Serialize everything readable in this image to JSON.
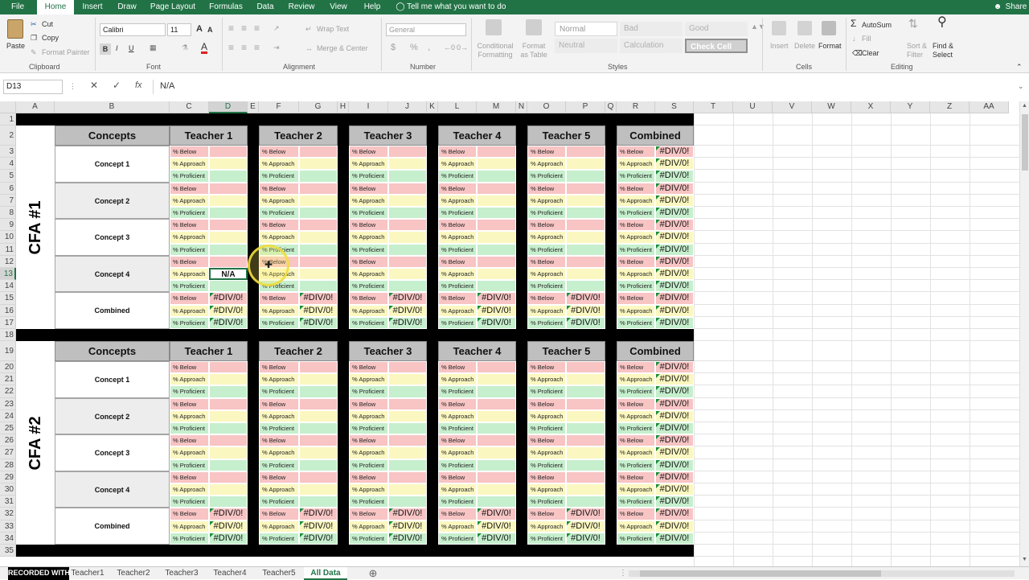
{
  "ribbon_tabs": [
    "File",
    "Home",
    "Insert",
    "Draw",
    "Page Layout",
    "Formulas",
    "Data",
    "Review",
    "View",
    "Help",
    "Tell me what you want to do"
  ],
  "active_tab": "Home",
  "share_label": "Share",
  "clipboard": {
    "paste": "Paste",
    "cut": "Cut",
    "copy": "Copy",
    "format_painter": "Format Painter",
    "label": "Clipboard"
  },
  "font": {
    "name": "Calibri",
    "size": "11",
    "label": "Font",
    "bold": "B",
    "italic": "I",
    "underline": "U",
    "grow": "A",
    "shrink": "A",
    "fontcolor": "A"
  },
  "alignment": {
    "wrap": "Wrap Text",
    "merge": "Merge & Center",
    "label": "Alignment"
  },
  "number": {
    "format": "General",
    "dollar": "$",
    "percent": "%",
    "comma": ",",
    "label": "Number"
  },
  "styles": {
    "conditional": "Conditional Formatting",
    "format_table": "Format as Table",
    "normal": "Normal",
    "bad": "Bad",
    "good": "Good",
    "neutral": "Neutral",
    "calculation": "Calculation",
    "check_cell": "Check Cell",
    "label": "Styles"
  },
  "cells": {
    "insert": "Insert",
    "delete": "Delete",
    "format": "Format",
    "label": "Cells"
  },
  "editing": {
    "autosum": "AutoSum",
    "fill": "Fill",
    "clear": "Clear",
    "sort": "Sort & Filter",
    "find": "Find & Select",
    "label": "Editing"
  },
  "formula_bar": {
    "name_box": "D13",
    "cancel": "✕",
    "enter": "✓",
    "fx": "fx",
    "content": "N/A"
  },
  "columns": [
    "A",
    "B",
    "C",
    "D",
    "E",
    "F",
    "G",
    "H",
    "I",
    "J",
    "K",
    "L",
    "M",
    "N",
    "O",
    "P",
    "Q",
    "R",
    "S",
    "T",
    "U",
    "V",
    "W",
    "X",
    "Y",
    "Z",
    "AA"
  ],
  "rows": [
    "1",
    "2",
    "3",
    "4",
    "5",
    "6",
    "7",
    "8",
    "9",
    "10",
    "11",
    "12",
    "13",
    "14",
    "15",
    "16",
    "17",
    "18",
    "19",
    "20",
    "21",
    "22",
    "23",
    "24",
    "25",
    "26",
    "27",
    "28",
    "29",
    "30",
    "31",
    "32",
    "33",
    "34",
    "35"
  ],
  "blocks": [
    {
      "title": "CFA #1"
    },
    {
      "title": "CFA #2"
    }
  ],
  "headers": {
    "concepts": "Concepts",
    "teachers": [
      "Teacher 1",
      "Teacher 2",
      "Teacher 3",
      "Teacher 4",
      "Teacher 5"
    ],
    "combined": "Combined"
  },
  "concepts": [
    "Concept 1",
    "Concept 2",
    "Concept 3",
    "Concept 4",
    "Combined"
  ],
  "levels": [
    "% Below",
    "% Approach",
    "% Proficient"
  ],
  "error_value": "#DIV/0!",
  "selected_value": "N/A",
  "sheet_tabs": [
    "Teacher1",
    "Teacher2",
    "Teacher3",
    "Teacher4",
    "Teacher5",
    "All Data"
  ],
  "active_sheet": "All Data",
  "watermark": "RECORDED WITH",
  "colors": {
    "excel_green": "#217346",
    "below": "#f8c4c4",
    "approach": "#fbf7c0",
    "proficient": "#c6efcd",
    "header_gray": "#bfbfbf"
  }
}
